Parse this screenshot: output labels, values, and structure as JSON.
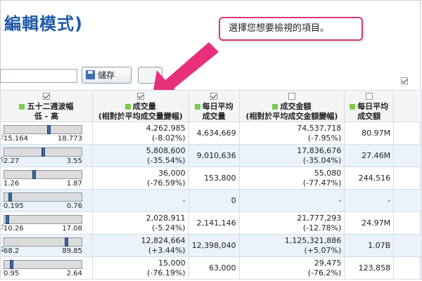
{
  "header": {
    "title": "編輯模式)",
    "tooltip": "選擇您想要檢視的項目。"
  },
  "toolbar": {
    "save_label": "儲存",
    "top_checkbox_checked": true
  },
  "columns": [
    {
      "label": "五十二週波幅",
      "sub": "低 - 高",
      "checked": true
    },
    {
      "label": "成交量",
      "sub": "(相對於平均成交量變幅)",
      "checked": true
    },
    {
      "label": "每日平均",
      "sub": "成交量",
      "checked": true
    },
    {
      "label": "成交金額",
      "sub": "(相對於平均成交金額變幅)",
      "checked": false
    },
    {
      "label": "每日平均",
      "sub": "成交額",
      "checked": false
    }
  ],
  "rows": [
    {
      "cut": "3",
      "low": "15.164",
      "high": "18.773",
      "range_pos": 0.58,
      "vol": "4,262,985",
      "vol_chg": "(-8.02%)",
      "avg_vol": "4,634,669",
      "turnover": "74,537,718",
      "turnover_chg": "(-7.95%)",
      "avg_turn": "80.97M"
    },
    {
      "cut": "9",
      "low": "2.27",
      "high": "3.55",
      "range_pos": 0.5,
      "vol": "5,808,600",
      "vol_chg": "(-35.54%)",
      "avg_vol": "9,010,636",
      "turnover": "17,836,676",
      "turnover_chg": "(-35.04%)",
      "avg_turn": "27.46M"
    },
    {
      "cut": "",
      "low": "1.26",
      "high": "1.87",
      "range_pos": 0.38,
      "vol": "36,000",
      "vol_chg": "(-76.59%)",
      "avg_vol": "153,800",
      "turnover": "55,080",
      "turnover_chg": "(-77.47%)",
      "avg_turn": "244,516"
    },
    {
      "cut": "",
      "low": "0.195",
      "high": "0.76",
      "range_pos": 0.06,
      "vol": "-",
      "vol_chg": "",
      "avg_vol": "0",
      "turnover": "-",
      "turnover_chg": "",
      "avg_turn": "-"
    },
    {
      "cut": "3",
      "low": "10.26",
      "high": "17.08",
      "range_pos": 0.02,
      "vol": "2,028,911",
      "vol_chg": "(-5.24%)",
      "avg_vol": "2,141,146",
      "turnover": "21,777,293",
      "turnover_chg": "(-12.78%)",
      "avg_turn": "24.97M"
    },
    {
      "cut": "2",
      "low": "68.2",
      "high": "89.85",
      "range_pos": 0.82,
      "vol": "12,824,664",
      "vol_chg": "(+3.44%)",
      "avg_vol": "12,398,040",
      "turnover": "1,125,321,886",
      "turnover_chg": "(+5.07%)",
      "avg_turn": "1.07B"
    },
    {
      "cut": "",
      "low": "0.95",
      "high": "2.64",
      "range_pos": 0.08,
      "vol": "15,000",
      "vol_chg": "(-76.19%)",
      "avg_vol": "63,000",
      "turnover": "29,475",
      "turnover_chg": "(-76.2%)",
      "avg_turn": "123,858"
    }
  ]
}
